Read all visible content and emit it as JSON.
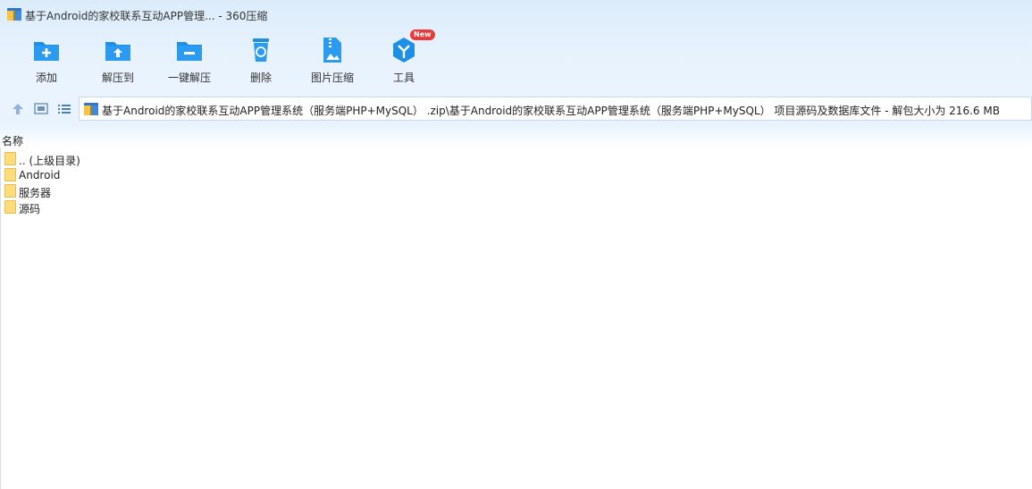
{
  "window": {
    "title": "基于Android的家校联系互动APP管理... - 360压缩"
  },
  "toolbar": {
    "items": [
      {
        "label": "添加",
        "icon": "add-folder-icon"
      },
      {
        "label": "解压到",
        "icon": "extract-to-icon"
      },
      {
        "label": "一键解压",
        "icon": "one-click-extract-icon"
      },
      {
        "label": "删除",
        "icon": "trash-icon"
      },
      {
        "label": "图片压缩",
        "icon": "image-compress-icon"
      },
      {
        "label": "工具",
        "icon": "tools-icon",
        "badge": "New"
      }
    ]
  },
  "path": {
    "text": "基于Android的家校联系互动APP管理系统（服务端PHP+MySQL） .zip\\基于Android的家校联系互动APP管理系统（服务端PHP+MySQL） 项目源码及数据库文件 - 解包大小为 216.6 MB"
  },
  "list": {
    "header": "名称",
    "items": [
      ".. (上级目录)",
      "Android",
      "服务器",
      "源码"
    ]
  },
  "colors": {
    "accent": "#1e8fe6",
    "folder": "#fddc7a",
    "badge": "#e83a3a"
  }
}
